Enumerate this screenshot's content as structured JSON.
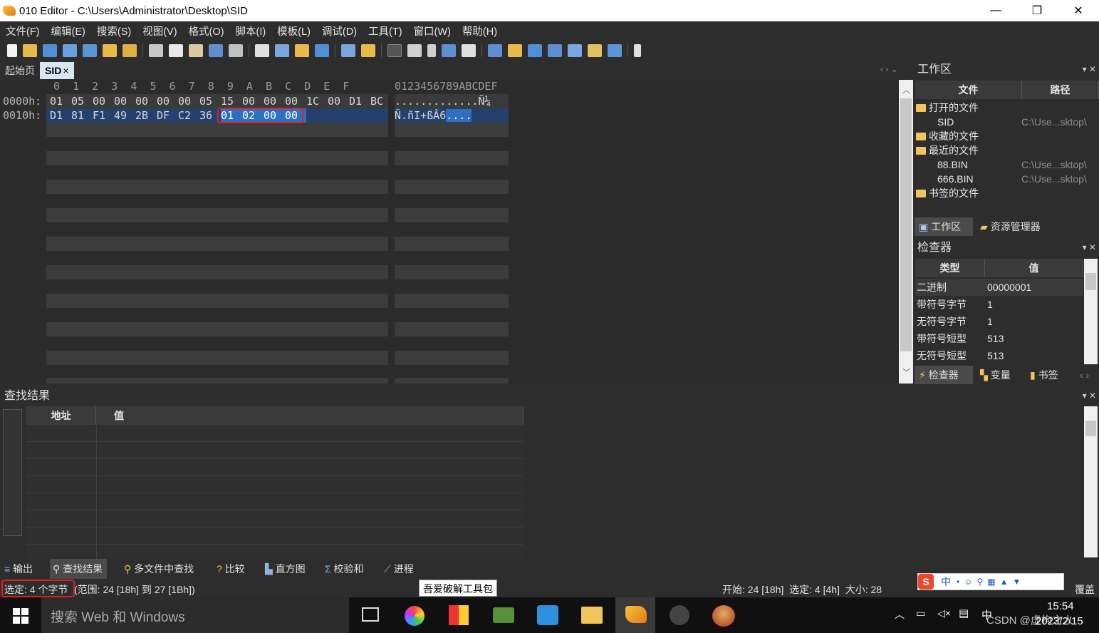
{
  "window": {
    "title": "010 Editor - C:\\Users\\Administrator\\Desktop\\SID",
    "minimize": "—",
    "maximize": "❐",
    "close": "✕"
  },
  "menu": [
    "文件(F)",
    "编辑(E)",
    "搜索(S)",
    "视图(V)",
    "格式(O)",
    "脚本(I)",
    "模板(L)",
    "调试(D)",
    "工具(T)",
    "窗口(W)",
    "帮助(H)"
  ],
  "tabs": {
    "start": "起始页",
    "file": "SID",
    "close": "×"
  },
  "hex": {
    "header": "0  1  2  3  4  5  6  7  8  9  A  B  C  D  E  F",
    "ascii_header": "0123456789ABCDEF",
    "rows": [
      {
        "addr": "0000h:",
        "bytes": [
          "01",
          "05",
          "00",
          "00",
          "00",
          "00",
          "00",
          "05",
          "15",
          "00",
          "00",
          "00",
          "1C",
          "00",
          "D1",
          "BC"
        ],
        "ascii": ".............Ñ¼"
      },
      {
        "addr": "0010h:",
        "bytes": [
          "D1",
          "81",
          "F1",
          "49",
          "2B",
          "DF",
          "C2",
          "36",
          "01",
          "02",
          "00",
          "00"
        ],
        "ascii_plain": "Ñ.ñI+ßÂ6",
        "ascii_sel": "...."
      }
    ]
  },
  "workspace": {
    "title": "工作区",
    "col_file": "文件",
    "col_path": "路径",
    "open_files": "打开的文件",
    "open_item": "SID",
    "open_item_path": "C:\\Use...sktop\\",
    "favorites": "收藏的文件",
    "recent": "最近的文件",
    "recent_items": [
      {
        "name": "88.BIN",
        "path": "C:\\Use...sktop\\"
      },
      {
        "name": "666.BIN",
        "path": "C:\\Use...sktop\\"
      }
    ],
    "bookmarks": "书签的文件",
    "tab_workspace": "工作区",
    "tab_explorer": "资源管理器"
  },
  "inspector": {
    "title": "检查器",
    "col_type": "类型",
    "col_value": "值",
    "rows": [
      {
        "type": "二进制",
        "value": "00000001"
      },
      {
        "type": "带符号字节",
        "value": "1"
      },
      {
        "type": "无符号字节",
        "value": "1"
      },
      {
        "type": "带符号短型",
        "value": "513"
      },
      {
        "type": "无符号短型",
        "value": "513"
      }
    ],
    "tab_inspector": "检查器",
    "tab_vars": "变量",
    "tab_bookmarks": "书签"
  },
  "find": {
    "title": "查找结果",
    "col_addr": "地址",
    "col_value": "值"
  },
  "bottom_tabs": [
    "输出",
    "查找结果",
    "多文件中查找",
    "比较",
    "直方图",
    "校验和",
    "进程"
  ],
  "status": {
    "selected": "选定: 4 个字节",
    "range": "(范围: 24 [18h] 到 27 [1Bh])",
    "tooltip": "吾爱破解工具包",
    "right": "开始: 24 [18h]  选定: 4 [4h]  大小: 28",
    "mode": "覆盖",
    "ime": "中"
  },
  "taskbar": {
    "search": "搜索 Web 和 Windows",
    "time": "15:54",
    "date": "2023/2/15",
    "ime": "中",
    "watermark": "CSDN @虚构之人"
  }
}
